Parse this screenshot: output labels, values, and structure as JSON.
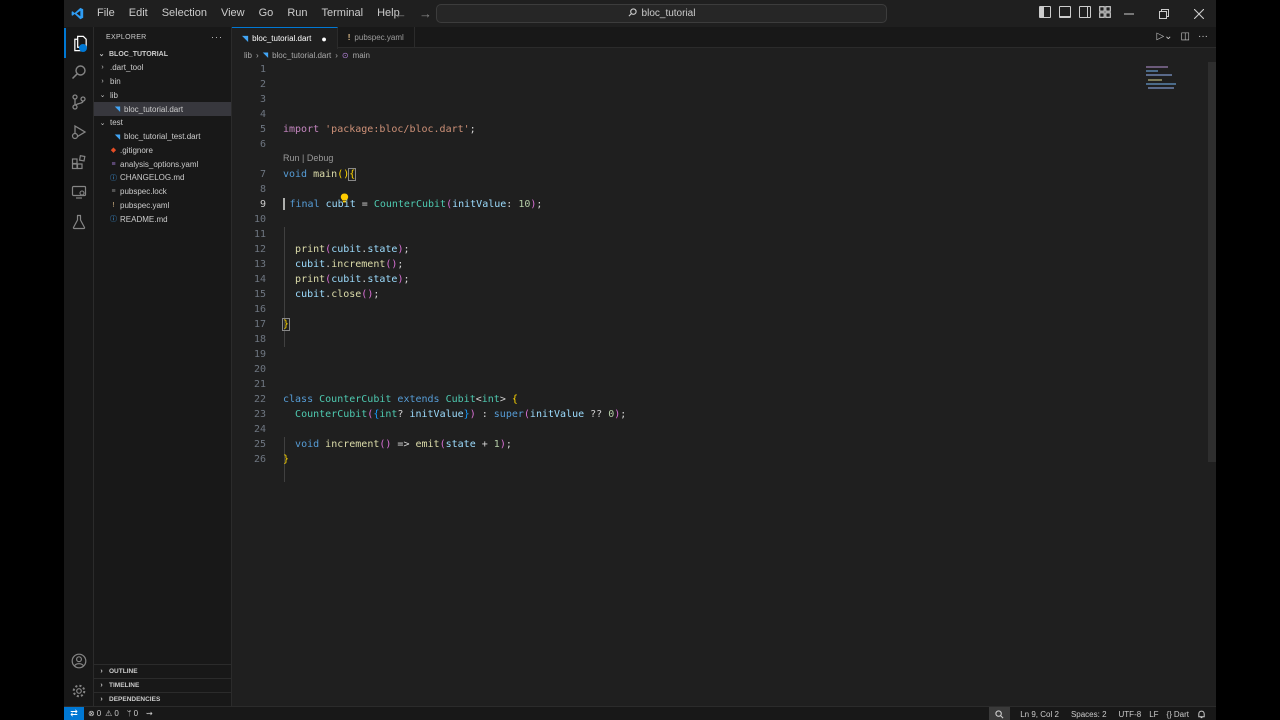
{
  "title_bar": {
    "menus": [
      "File",
      "Edit",
      "Selection",
      "View",
      "Go",
      "Run",
      "Terminal",
      "Help"
    ],
    "search_text": "bloc_tutorial"
  },
  "sidebar": {
    "header": "EXPLORER",
    "folder": "BLOC_TUTORIAL",
    "items": [
      {
        "label": ".dart_tool",
        "kind": "folder",
        "expanded": false,
        "depth": 0
      },
      {
        "label": "bin",
        "kind": "folder",
        "expanded": false,
        "depth": 0
      },
      {
        "label": "lib",
        "kind": "folder",
        "expanded": true,
        "depth": 0
      },
      {
        "label": "bloc_tutorial.dart",
        "kind": "dart",
        "depth": 1,
        "selected": true
      },
      {
        "label": "test",
        "kind": "folder",
        "expanded": true,
        "depth": 0
      },
      {
        "label": "bloc_tutorial_test.dart",
        "kind": "dart",
        "depth": 1
      },
      {
        "label": ".gitignore",
        "kind": "git",
        "depth": 0
      },
      {
        "label": "analysis_options.yaml",
        "kind": "yaml",
        "depth": 0
      },
      {
        "label": "CHANGELOG.md",
        "kind": "info",
        "depth": 0
      },
      {
        "label": "pubspec.lock",
        "kind": "lock",
        "depth": 0
      },
      {
        "label": "pubspec.yaml",
        "kind": "yaml-warn",
        "depth": 0
      },
      {
        "label": "README.md",
        "kind": "info",
        "depth": 0
      }
    ],
    "sections": [
      "OUTLINE",
      "TIMELINE",
      "DEPENDENCIES"
    ]
  },
  "tabs": [
    {
      "label": "bloc_tutorial.dart",
      "active": true,
      "dirty": true
    },
    {
      "label": "pubspec.yaml",
      "active": false,
      "dirty": false
    }
  ],
  "breadcrumb": [
    "lib",
    "bloc_tutorial.dart",
    "main"
  ],
  "codelens": "Run | Debug",
  "status_bar": {
    "errors": "0",
    "warnings": "0",
    "ports": "0",
    "position": "Ln 9, Col 2",
    "spaces": "Spaces: 2",
    "encoding": "UTF-8",
    "eol": "LF",
    "language": "Dart"
  },
  "colors": {
    "accent": "#0078d4",
    "editor_bg": "#1f1f1f",
    "sidebar_bg": "#181818"
  }
}
